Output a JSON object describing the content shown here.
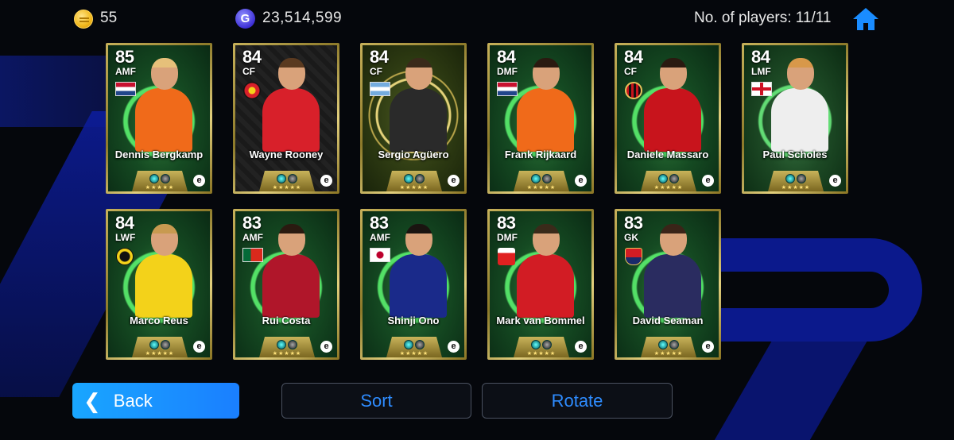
{
  "header": {
    "coins_icon": "coin-icon",
    "coins": "55",
    "gp_icon_letter": "G",
    "gp": "23,514,599",
    "player_count_label": "No. of players: 11/11",
    "home_icon": "home-icon"
  },
  "cards": [
    {
      "rating": "85",
      "position": "AMF",
      "name": "Dennis Bergkamp",
      "flag": "netherlands",
      "style": "green",
      "shirt": "#f06a1a",
      "hair": "#e6c07a"
    },
    {
      "rating": "84",
      "position": "CF",
      "name": "Wayne Rooney",
      "flag": "man-utd",
      "style": "dark",
      "shirt": "#d8202a",
      "hair": "#5a3a20"
    },
    {
      "rating": "84",
      "position": "CF",
      "name": "Sergio Agüero",
      "flag": "argentina",
      "style": "gold",
      "shirt": "#2a2a2a",
      "hair": "#3a2a1a"
    },
    {
      "rating": "84",
      "position": "DMF",
      "name": "Frank Rijkaard",
      "flag": "netherlands",
      "style": "green",
      "shirt": "#f06a1a",
      "hair": "#2a1a10"
    },
    {
      "rating": "84",
      "position": "CF",
      "name": "Daniele Massaro",
      "flag": "ac-milan",
      "style": "green",
      "shirt": "#c8141c",
      "hair": "#2a1a10"
    },
    {
      "rating": "84",
      "position": "LMF",
      "name": "Paul Scholes",
      "flag": "england",
      "style": "light",
      "shirt": "#eeeeee",
      "hair": "#d8984a"
    },
    {
      "rating": "84",
      "position": "LWF",
      "name": "Marco Reus",
      "flag": "dortmund",
      "style": "green",
      "shirt": "#f3d21a",
      "hair": "#c89a50"
    },
    {
      "rating": "83",
      "position": "AMF",
      "name": "Rui Costa",
      "flag": "portugal",
      "style": "green",
      "shirt": "#b0162a",
      "hair": "#2a1a10"
    },
    {
      "rating": "83",
      "position": "AMF",
      "name": "Shinji Ono",
      "flag": "japan",
      "style": "green",
      "shirt": "#1a2a8a",
      "hair": "#1a1410"
    },
    {
      "rating": "83",
      "position": "DMF",
      "name": "Mark van Bommel",
      "flag": "psv",
      "style": "green",
      "shirt": "#d21c24",
      "hair": "#3a2a1a"
    },
    {
      "rating": "83",
      "position": "GK",
      "name": "David Seaman",
      "flag": "arsenal",
      "style": "green",
      "shirt": "#2a2c60",
      "hair": "#3a2418"
    }
  ],
  "card_stars": "★★★★★",
  "card_logo": "e",
  "buttons": {
    "back": "Back",
    "sort": "Sort",
    "rotate": "Rotate"
  },
  "colors": {
    "accent": "#1a8cff",
    "card_frame": "#c7b15a"
  }
}
